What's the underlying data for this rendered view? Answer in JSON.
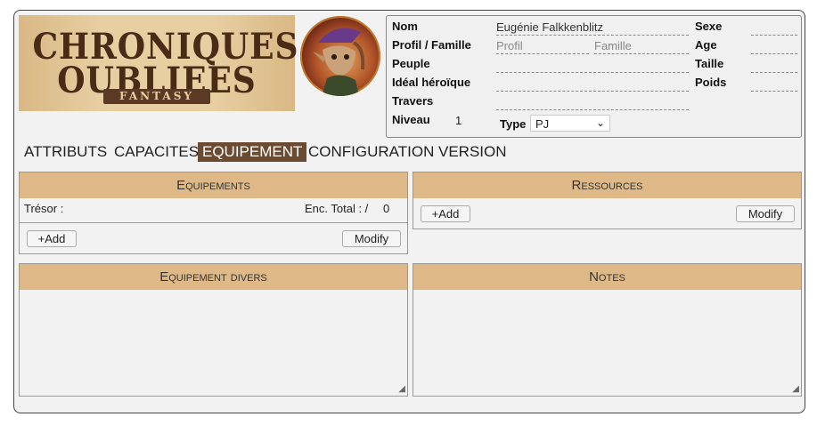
{
  "logo": {
    "line1": "CHRONIQUES",
    "line2": "OUBLIEES",
    "line3": "FANTASY"
  },
  "character": {
    "labels": {
      "name": "Nom",
      "profile": "Profil / Famille",
      "people": "Peuple",
      "ideal": "Idéal héroïque",
      "flaw": "Travers",
      "level": "Niveau",
      "sex": "Sexe",
      "age": "Age",
      "height": "Taille",
      "weight": "Poids",
      "type": "Type"
    },
    "values": {
      "name": "Eugénie Falkkenblitz",
      "profile_placeholder": "Profil",
      "family_placeholder": "Famille",
      "level": "1",
      "type": "PJ"
    }
  },
  "tabs": [
    "ATTRIBUTS",
    "CAPACITES",
    "EQUIPEMENT",
    "CONFIGURATION",
    "VERSION"
  ],
  "active_tab": "EQUIPEMENT",
  "equipements": {
    "title": "Equipements",
    "treasure_label": "Trésor :",
    "enc_label": "Enc. Total : /",
    "enc_value": "0",
    "add": "+Add",
    "modify": "Modify"
  },
  "ressources": {
    "title": "Ressources",
    "add": "+Add",
    "modify": "Modify"
  },
  "divers": {
    "title": "Equipement divers"
  },
  "notes": {
    "title": "Notes"
  }
}
